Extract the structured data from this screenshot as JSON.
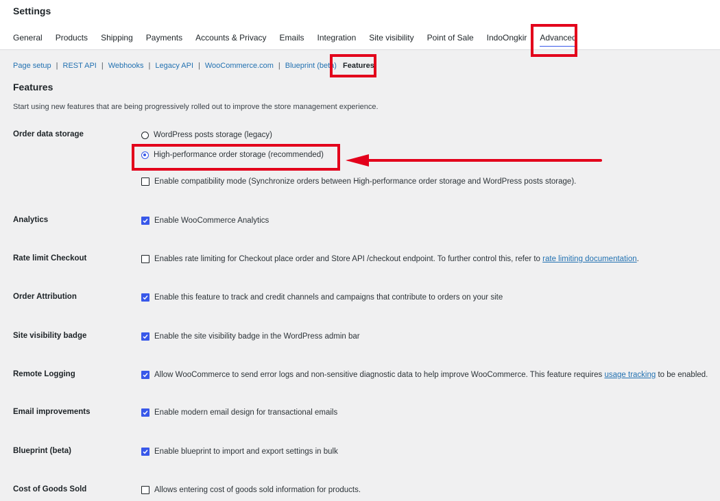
{
  "header": {
    "title": "Settings",
    "tabs": [
      {
        "label": "General"
      },
      {
        "label": "Products"
      },
      {
        "label": "Shipping"
      },
      {
        "label": "Payments"
      },
      {
        "label": "Accounts & Privacy"
      },
      {
        "label": "Emails"
      },
      {
        "label": "Integration"
      },
      {
        "label": "Site visibility"
      },
      {
        "label": "Point of Sale"
      },
      {
        "label": "IndoOngkir"
      },
      {
        "label": "Advanced",
        "active": true
      }
    ]
  },
  "subnav": {
    "items": [
      "Page setup",
      "REST API",
      "Webhooks",
      "Legacy API",
      "WooCommerce.com",
      "Blueprint (beta)"
    ],
    "separator": "|",
    "current": "Features"
  },
  "section": {
    "title": "Features",
    "description": "Start using new features that are being progressively rolled out to improve the store management experience."
  },
  "rows": {
    "order_data_storage": {
      "label": "Order data storage",
      "opt_legacy": "WordPress posts storage (legacy)",
      "opt_hpos": "High-performance order storage (recommended)",
      "opt_compat": "Enable compatibility mode (Synchronize orders between High-performance order storage and WordPress posts storage)."
    },
    "analytics": {
      "label": "Analytics",
      "text": "Enable WooCommerce Analytics",
      "checked": true
    },
    "rate_limit": {
      "label": "Rate limit Checkout",
      "text": "Enables rate limiting for Checkout place order and Store API /checkout endpoint. To further control this, refer to",
      "link": "rate limiting documentation",
      "suffix": ".",
      "checked": false
    },
    "order_attribution": {
      "label": "Order Attribution",
      "text": "Enable this feature to track and credit channels and campaigns that contribute to orders on your site",
      "checked": true
    },
    "site_visibility_badge": {
      "label": "Site visibility badge",
      "text": "Enable the site visibility badge in the WordPress admin bar",
      "checked": true
    },
    "remote_logging": {
      "label": "Remote Logging",
      "text": "Allow WooCommerce to send error logs and non-sensitive diagnostic data to help improve WooCommerce. This feature requires",
      "link": "usage tracking",
      "suffix": "to be enabled.",
      "checked": true
    },
    "email_improvements": {
      "label": "Email improvements",
      "text": "Enable modern email design for transactional emails",
      "checked": true
    },
    "blueprint": {
      "label": "Blueprint (beta)",
      "text": "Enable blueprint to import and export settings in bulk",
      "checked": true
    },
    "cogs": {
      "label": "Cost of Goods Sold",
      "text": "Allows entering cost of goods sold information for products.",
      "checked": false
    }
  },
  "colors": {
    "accent": "#3858e9",
    "highlight": "#e3001b",
    "link": "#2271b1"
  }
}
